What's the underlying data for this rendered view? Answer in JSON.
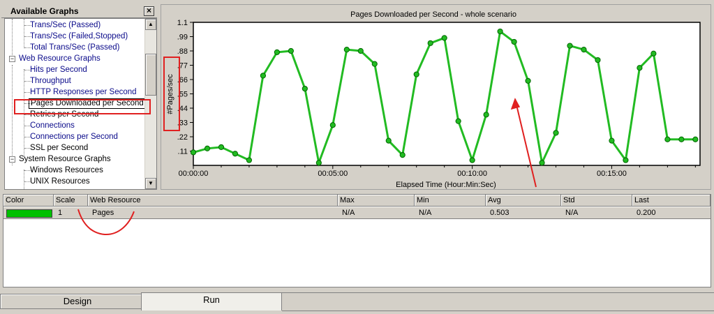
{
  "tree": {
    "title": "Available Graphs",
    "close_label": "×",
    "items": [
      {
        "label": "Trans/Sec (Passed)",
        "kind": "leaf"
      },
      {
        "label": "Trans/Sec (Failed,Stopped)",
        "kind": "leaf"
      },
      {
        "label": "Total Trans/Sec (Passed)",
        "kind": "leaf"
      },
      {
        "label": "Web Resource Graphs",
        "kind": "group"
      },
      {
        "label": "Hits per Second",
        "kind": "leaf"
      },
      {
        "label": "Throughput",
        "kind": "leaf"
      },
      {
        "label": "HTTP Responses per Second",
        "kind": "leaf"
      },
      {
        "label": "Pages Downloaded per Second",
        "kind": "leaf",
        "selected": true
      },
      {
        "label": "Retries per Second",
        "kind": "leaf"
      },
      {
        "label": "Connections",
        "kind": "leaf"
      },
      {
        "label": "Connections per Second",
        "kind": "leaf"
      },
      {
        "label": "SSL per Second",
        "kind": "leaf"
      },
      {
        "label": "System Resource Graphs",
        "kind": "group"
      },
      {
        "label": "Windows Resources",
        "kind": "leaf"
      },
      {
        "label": "UNIX Resources",
        "kind": "leaf"
      }
    ]
  },
  "chart_data": {
    "type": "line",
    "title": "Pages Downloaded per Second - whole scenario",
    "xlabel": "Elapsed Time (Hour:Min:Sec)",
    "ylabel": "#Pages/sec",
    "x_tick_labels": [
      "00:00:00",
      "00:05:00",
      "00:10:00",
      "00:15:00"
    ],
    "x_tick_seconds": [
      0,
      300,
      600,
      900
    ],
    "xlim": [
      0,
      1090
    ],
    "y_tick_labels": [
      ".11",
      ".22",
      ".33",
      ".44",
      ".55",
      ".66",
      ".77",
      ".88",
      ".99",
      "1.1"
    ],
    "y_tick_values": [
      0.11,
      0.22,
      0.33,
      0.44,
      0.55,
      0.66,
      0.77,
      0.88,
      0.99,
      1.1
    ],
    "ylim": [
      0,
      1.1
    ],
    "grid": false,
    "series": [
      {
        "color": "#22bb22",
        "x": [
          0,
          30,
          60,
          90,
          120,
          150,
          180,
          210,
          240,
          270,
          300,
          330,
          360,
          390,
          420,
          450,
          480,
          510,
          540,
          570,
          600,
          630,
          660,
          690,
          720,
          750,
          780,
          810,
          840,
          870,
          900,
          930,
          960,
          990,
          1020,
          1050,
          1080
        ],
        "y": [
          0.1,
          0.13,
          0.14,
          0.09,
          0.04,
          0.69,
          0.87,
          0.88,
          0.59,
          0.02,
          0.31,
          0.89,
          0.88,
          0.78,
          0.19,
          0.08,
          0.7,
          0.94,
          0.98,
          0.34,
          0.04,
          0.39,
          1.03,
          0.95,
          0.65,
          0.02,
          0.25,
          0.92,
          0.89,
          0.81,
          0.19,
          0.04,
          0.75,
          0.86,
          0.2,
          0.2,
          0.2
        ]
      }
    ]
  },
  "legend": {
    "headers": [
      "Color",
      "Scale",
      "Web Resource",
      "Max",
      "Min",
      "Avg",
      "Std",
      "Last"
    ],
    "rows": [
      {
        "color": "#00c000",
        "scale": "1",
        "resource": "Pages",
        "max": "N/A",
        "min": "N/A",
        "avg": "0.503",
        "std": "N/A",
        "last": "0.200"
      }
    ]
  },
  "tabs": {
    "design": "Design",
    "run": "Run"
  }
}
